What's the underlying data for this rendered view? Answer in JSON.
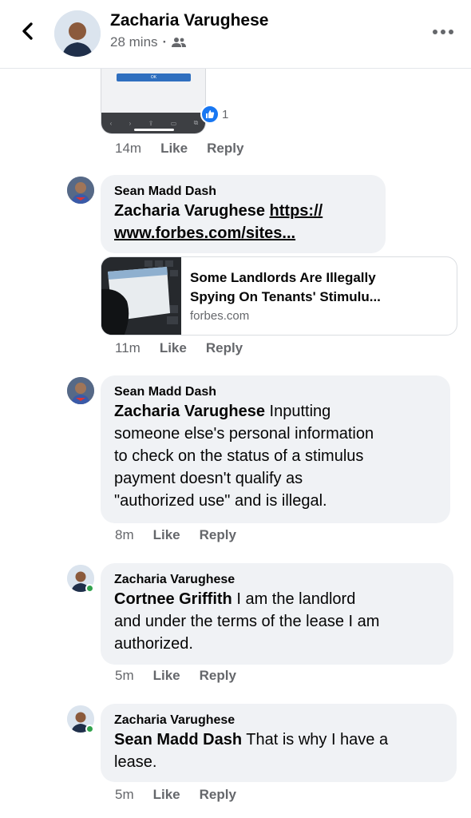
{
  "header": {
    "title": "Zacharia Varughese",
    "time": "28 mins",
    "dot": "·"
  },
  "screenshot_preview": {
    "ok_label": "OK",
    "reaction_count": "1"
  },
  "first_actions": {
    "time": "14m",
    "like": "Like",
    "reply": "Reply"
  },
  "comments": [
    {
      "author": "Sean Madd Dash",
      "mention": "Zacharia Varughese",
      "link_text_1": "https://",
      "link_text_2": "www.forbes.com/sites...",
      "link_card": {
        "title_1": "Some Landlords Are Illegally",
        "title_2": "Spying On Tenants' Stimulu...",
        "domain": "forbes.com"
      },
      "time": "11m",
      "like": "Like",
      "reply": "Reply"
    },
    {
      "author": "Sean Madd Dash",
      "mention": "Zacharia Varughese",
      "text_1": " Inputting",
      "text_2": "someone else's personal information",
      "text_3": "to check on the status of a stimulus",
      "text_4": "payment doesn't qualify as",
      "text_5": "\"authorized use\" and is illegal.",
      "time": "8m",
      "like": "Like",
      "reply": "Reply"
    },
    {
      "author": "Zacharia Varughese",
      "mention": "Cortnee Griffith",
      "text_1": " I am the landlord",
      "text_2": "and under the terms of the lease I am",
      "text_3": "authorized.",
      "time": "5m",
      "like": "Like",
      "reply": "Reply"
    },
    {
      "author": "Zacharia Varughese",
      "mention": "Sean Madd Dash",
      "text_1": " That is why I have a",
      "text_2": "lease.",
      "time": "5m",
      "like": "Like",
      "reply": "Reply"
    }
  ]
}
